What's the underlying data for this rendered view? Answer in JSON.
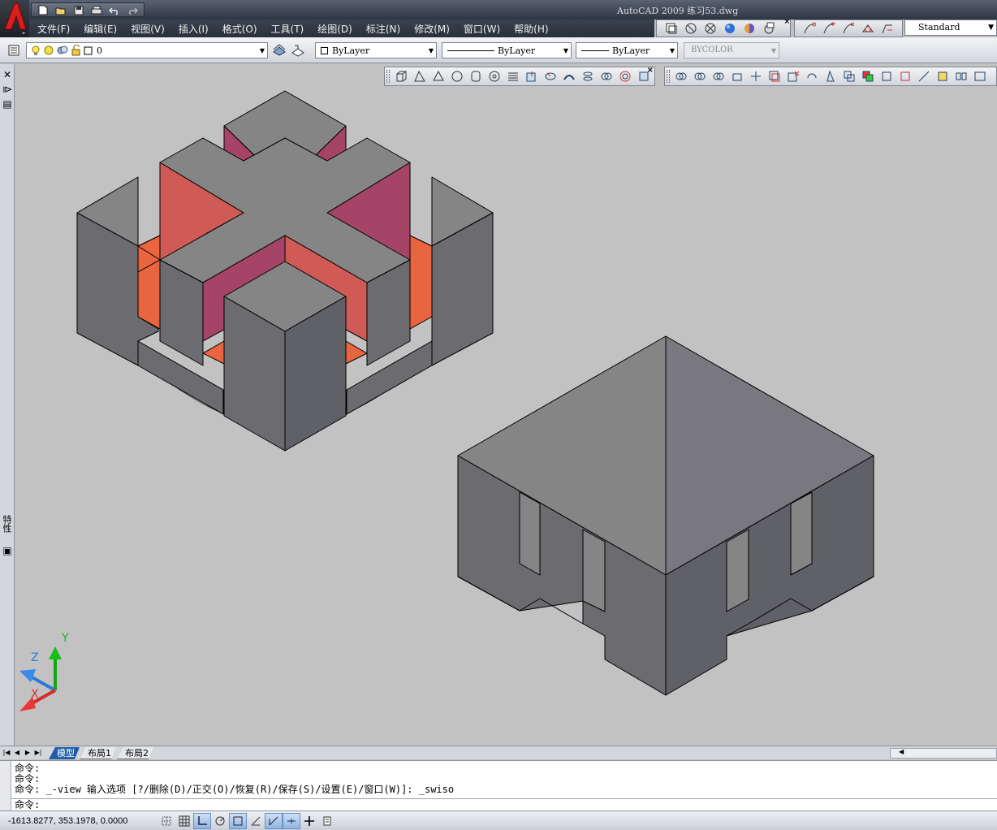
{
  "window": {
    "title": "AutoCAD 2009  练习53.dwg"
  },
  "menu": [
    "文件(F)",
    "编辑(E)",
    "视图(V)",
    "插入(I)",
    "格式(O)",
    "工具(T)",
    "绘图(D)",
    "标注(N)",
    "修改(M)",
    "窗口(W)",
    "帮助(H)"
  ],
  "toolbar": {
    "text_style": "Standard",
    "layer_name": "0",
    "color": "ByLayer",
    "linetype": "ByLayer",
    "lineweight": "ByLayer",
    "plot_style": "BYCOLOR"
  },
  "left_panel": {
    "label": "特性"
  },
  "ucs": {
    "x_label": "X",
    "y_label": "Y",
    "z_label": "Z"
  },
  "tabs": [
    "模型",
    "布局1",
    "布局2"
  ],
  "command_history": [
    "命令:",
    "命令:",
    "命令: _-view 输入选项 [?/删除(D)/正交(O)/恢复(R)/保存(S)/设置(E)/窗口(W)]: _swiso"
  ],
  "command_prompt": "命令:",
  "status": {
    "coordinates": "-1613.8277, 353.1978, 0.0000"
  },
  "colors": {
    "background": "#c2c2c2",
    "solid_top": "#858585",
    "solid_side": "#6b6b70",
    "cut_red": "#d05a55",
    "cut_magenta": "#a64468",
    "cut_orange": "#e8653f"
  }
}
